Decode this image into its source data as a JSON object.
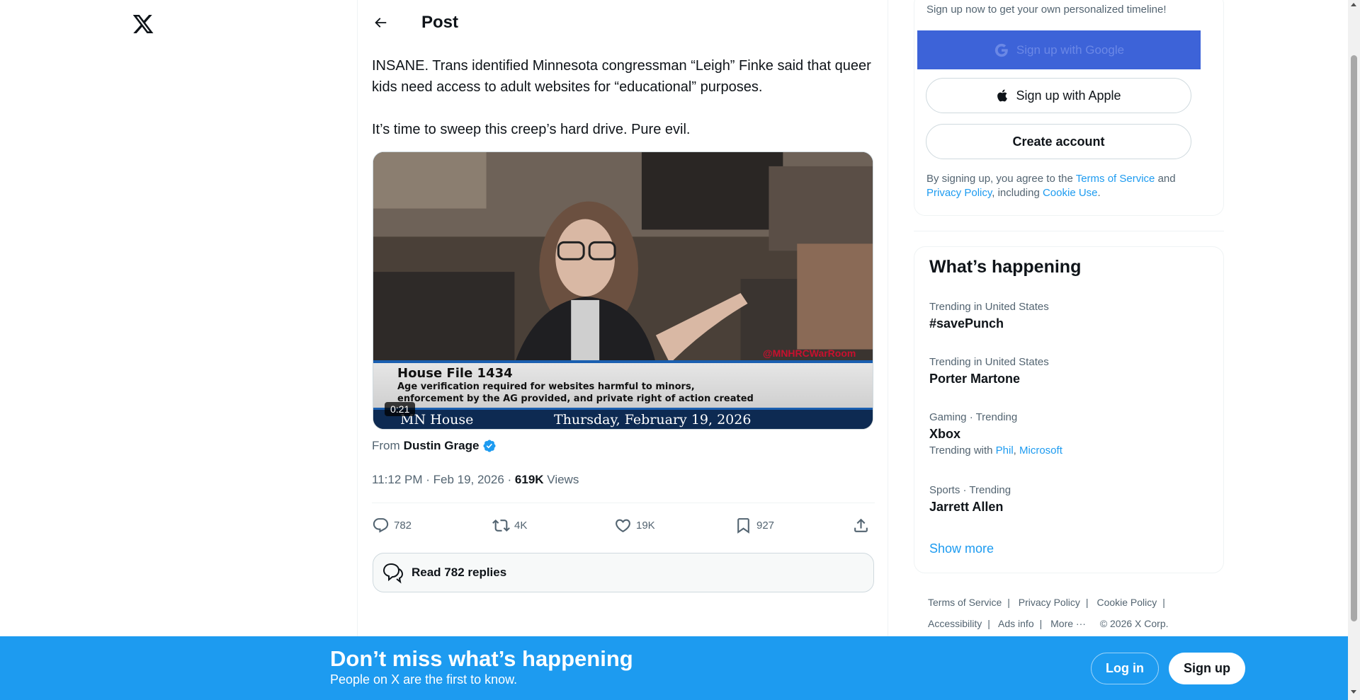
{
  "nav": {
    "logo_icon": "x-logo-icon"
  },
  "header": {
    "title": "Post",
    "back_icon": "arrow-left-icon"
  },
  "tweet": {
    "text_line1": "INSANE. Trans identified Minnesota congressman “Leigh” Finke said that queer kids need access to adult websites for “educational” purposes.",
    "text_line2": "It’s time to sweep this creep’s hard drive. Pure evil.",
    "video": {
      "lower_third_title": "House File 1434",
      "lower_third_sub_1": "Age verification required for websites harmful to minors,",
      "lower_third_sub_2": "enforcement by the AG provided, and private right of action created",
      "channel": "MN House",
      "date": "Thursday, February 19, 2026",
      "watermark": "@MNHRCWarRoom",
      "duration": "0:21"
    },
    "from_label": "From",
    "from_author": "Dustin Grage",
    "timestamp": "11:12 PM · Feb 19, 2026 · ",
    "views_count": "619K",
    "views_label": " Views",
    "actions": {
      "replies": "782",
      "reposts": "4K",
      "likes": "19K",
      "bookmarks": "927"
    },
    "read_replies": "Read 782 replies"
  },
  "signup": {
    "note": "Sign up now to get your own personalized timeline!",
    "google": "Sign up with Google",
    "apple": "Sign up with Apple",
    "create": "Create account",
    "legal_prefix": "By signing up, you agree to the ",
    "legal_tos": "Terms of Service",
    "legal_and": " and ",
    "legal_privacy": "Privacy Policy",
    "legal_including": ", including ",
    "legal_cookie": "Cookie Use",
    "legal_end": "."
  },
  "trends": {
    "title": "What’s happening",
    "items": [
      {
        "meta": "Trending in United States",
        "name": "#savePunch"
      },
      {
        "meta": "Trending in United States",
        "name": "Porter Martone"
      },
      {
        "meta": "Gaming · Trending",
        "name": "Xbox",
        "with_label": "Trending with ",
        "with_1": "Phil",
        "with_sep": ", ",
        "with_2": "Microsoft"
      },
      {
        "meta": "Sports · Trending",
        "name": "Jarrett Allen"
      }
    ],
    "show_more": "Show more"
  },
  "footer": {
    "links": [
      "Terms of Service",
      "Privacy Policy",
      "Cookie Policy",
      "Accessibility",
      "Ads info",
      "More ···"
    ],
    "copyright": "© 2026 X Corp."
  },
  "banner": {
    "title": "Don’t miss what’s happening",
    "subtitle": "People on X are the first to know.",
    "login": "Log in",
    "signup": "Sign up"
  },
  "colors": {
    "accent": "#1d9bf0",
    "text": "#0f1419",
    "muted": "#536471",
    "border": "#eff3f4"
  }
}
